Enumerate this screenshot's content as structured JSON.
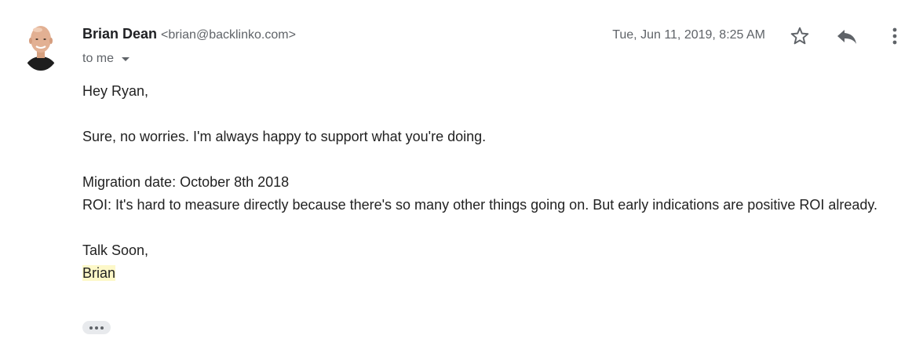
{
  "email": {
    "sender_name": "Brian Dean",
    "sender_email": "<brian@backlinko.com>",
    "recipient_label": "to me",
    "date": "Tue, Jun 11, 2019, 8:25 AM",
    "body": {
      "greeting": "Hey Ryan,",
      "line1": "Sure, no worries. I'm always happy to support what you're doing.",
      "line2": "Migration date: October 8th 2018",
      "line3": "ROI: It's hard to measure directly because there's so many other things going on. But early indications are positive ROI already.",
      "signoff": "Talk Soon,",
      "signature": "Brian"
    }
  },
  "icons": {
    "avatar": "avatar-photo",
    "star": "star-outline-icon",
    "reply": "reply-icon",
    "more": "more-vert-icon",
    "caret": "caret-down-icon",
    "trimmed": "show-trimmed-content-icon"
  },
  "colors": {
    "highlight": "#fdf8c8",
    "secondary_text": "#5f6368",
    "primary_text": "#222222"
  }
}
